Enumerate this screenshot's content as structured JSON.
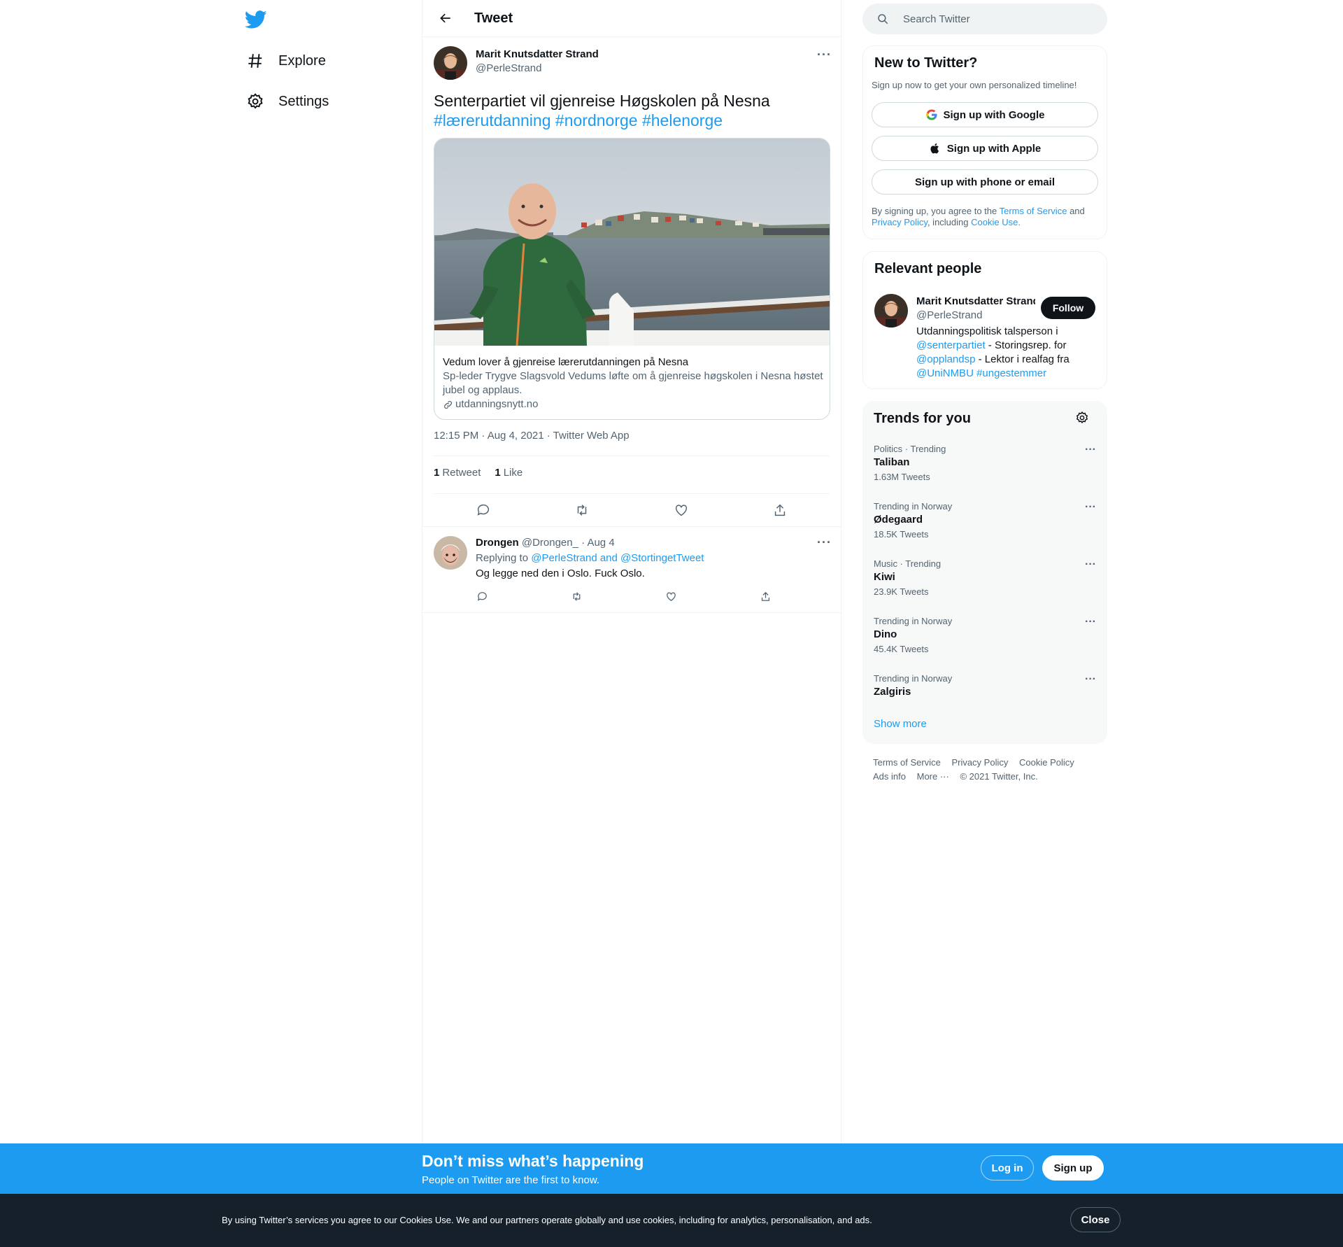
{
  "nav": {
    "items": [
      {
        "label": "Explore",
        "icon": "hashtag-icon"
      },
      {
        "label": "Settings",
        "icon": "gear-icon"
      }
    ]
  },
  "header": {
    "title": "Tweet"
  },
  "tweet": {
    "author_name": "Marit Knutsdatter Strand",
    "author_handle": "@PerleStrand",
    "text": "Senterpartiet vil gjenreise Høgskolen på Nesna",
    "hashtags": [
      "#lærerutdanning",
      "#nordnorge",
      "#helenorge"
    ],
    "card": {
      "title": "Vedum lover å gjenreise lærerutdanningen på Nesna",
      "description": "Sp-leder Trygve Slagsvold Vedums løfte om å gjenreise høgskolen i Nesna høstet jubel og applaus.",
      "domain": "utdanningsnytt.no"
    },
    "meta": "12:15 PM · Aug 4, 2021 · Twitter Web App",
    "retweets": "1",
    "retweets_label": "Retweet",
    "likes": "1",
    "likes_label": "Like"
  },
  "reply": {
    "author_name": "Drongen",
    "author_handle": "@Drongen_",
    "date": "· Aug 4",
    "replying_label": "Replying to",
    "replying_to": "@PerleStrand and @StortingetTweet",
    "text": "Og legge ned den i Oslo. Fuck Oslo."
  },
  "search": {
    "placeholder": "Search Twitter"
  },
  "signup": {
    "title": "New to Twitter?",
    "subtitle": "Sign up now to get your own personalized timeline!",
    "google_label": "Sign up with Google",
    "apple_label": "Sign up with Apple",
    "phone_label": "Sign up with phone or email",
    "legal_prefix": "By signing up, you agree to the",
    "terms_link": "Terms of Service",
    "and": "and",
    "privacy_link": "Privacy Policy",
    "including": ", including",
    "cookie_link": "Cookie Use."
  },
  "relevant": {
    "title": "Relevant people",
    "name": "Marit Knutsdatter Strand",
    "handle": "@PerleStrand",
    "follow_label": "Follow",
    "bio_1": "Utdanningspolitisk talsperson i",
    "bio_link_1": "@senterpartiet",
    "bio_2": " - Storingsrep. for",
    "bio_link_2": "@opplandsp",
    "bio_3": " - Lektor i realfag fra",
    "bio_link_3": "@UniNMBU",
    "bio_link_4": "#ungestemmer"
  },
  "trends": {
    "title": "Trends for you",
    "items": [
      {
        "context": "Politics · Trending",
        "name": "Taliban",
        "count": "1.63M Tweets"
      },
      {
        "context": "Trending in Norway",
        "name": "Ødegaard",
        "count": "18.5K Tweets"
      },
      {
        "context": "Music · Trending",
        "name": "Kiwi",
        "count": "23.9K Tweets"
      },
      {
        "context": "Trending in Norway",
        "name": "Dino",
        "count": "45.4K Tweets"
      },
      {
        "context": "Trending in Norway",
        "name": "Zalgiris",
        "count": ""
      }
    ],
    "show_more": "Show more"
  },
  "footer": {
    "terms": "Terms of Service",
    "privacy": "Privacy Policy",
    "cookie": "Cookie Policy",
    "ads": "Ads info",
    "more": "More ···",
    "copyright": "© 2021 Twitter, Inc."
  },
  "banner": {
    "title": "Don’t miss what’s happening",
    "subtitle": "People on Twitter are the first to know.",
    "login": "Log in",
    "signup": "Sign up"
  },
  "cookie": {
    "text": "By using Twitter’s services you agree to our Cookies Use. We and our partners operate globally and use cookies, including for analytics, personalisation, and ads.",
    "close": "Close"
  },
  "colors": {
    "accent": "#1d9bf0",
    "text": "#0f1419",
    "secondary": "#536471",
    "cookie_bg": "#15202b"
  }
}
